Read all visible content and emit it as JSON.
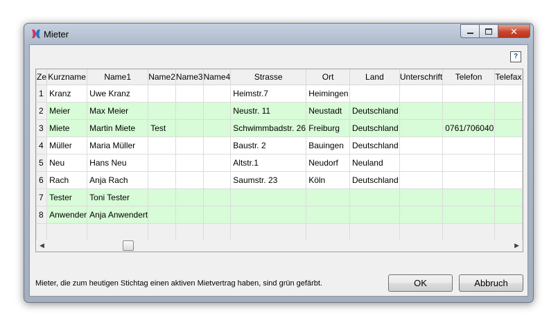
{
  "window": {
    "title": "Mieter"
  },
  "help_label": "?",
  "columns": [
    "Ze",
    "Kurzname",
    "Name1",
    "Name2",
    "Name3",
    "Name4",
    "Strasse",
    "Ort",
    "Land",
    "Unterschrift",
    "Telefon",
    "Telefax"
  ],
  "rows": [
    {
      "n": "1",
      "kurz": "Kranz",
      "name1": "Uwe Kranz",
      "name2": "",
      "strasse": "Heimstr.7",
      "ort": "Heimingen",
      "land": "",
      "telefon": "",
      "active": false
    },
    {
      "n": "2",
      "kurz": "Meier",
      "name1": "Max Meier",
      "name2": "",
      "strasse": "Neustr. 11",
      "ort": "Neustadt",
      "land": "Deutschland",
      "telefon": "",
      "active": true
    },
    {
      "n": "3",
      "kurz": "Miete",
      "name1": "Martin Miete",
      "name2": "Test",
      "strasse": "Schwimmbadstr. 26",
      "ort": "Freiburg",
      "land": "Deutschland",
      "telefon": "0761/706040",
      "active": true
    },
    {
      "n": "4",
      "kurz": "Müller",
      "name1": "Maria Müller",
      "name2": "",
      "strasse": "Baustr. 2",
      "ort": "Bauingen",
      "land": "Deutschland",
      "telefon": "",
      "active": false
    },
    {
      "n": "5",
      "kurz": "Neu",
      "name1": "Hans Neu",
      "name2": "",
      "strasse": "Altstr.1",
      "ort": "Neudorf",
      "land": "Neuland",
      "telefon": "",
      "active": false
    },
    {
      "n": "6",
      "kurz": "Rach",
      "name1": "Anja Rach",
      "name2": "",
      "strasse": "Saumstr. 23",
      "ort": "Köln",
      "land": "Deutschland",
      "telefon": "",
      "active": false
    },
    {
      "n": "7",
      "kurz": "Tester",
      "name1": "Toni Tester",
      "name2": "",
      "strasse": "",
      "ort": "",
      "land": "",
      "telefon": "",
      "active": true
    },
    {
      "n": "8",
      "kurz": "Anwender",
      "name1": "Anja Anwendert",
      "name2": "",
      "strasse": "",
      "ort": "",
      "land": "",
      "telefon": "",
      "active": true
    }
  ],
  "status_text": "Mieter, die zum heutigen Stichtag einen aktiven Mietvertrag haben, sind grün gefärbt.",
  "buttons": {
    "ok": "OK",
    "cancel": "Abbruch"
  },
  "colors": {
    "active_row": "#d8fbd8"
  }
}
